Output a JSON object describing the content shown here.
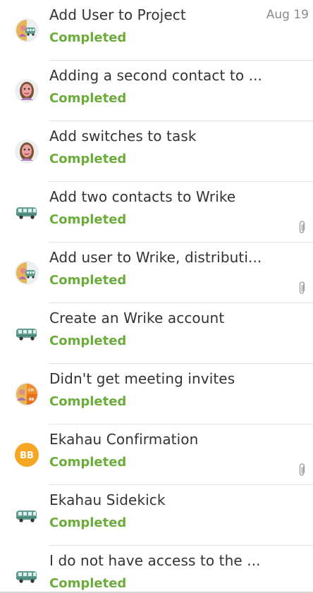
{
  "tasks": [
    {
      "title": "Add User to Project",
      "status": "Completed",
      "date": "Aug 19",
      "avatar": "user-bus-avatar-icon",
      "attachment": false
    },
    {
      "title": "Adding a second contact to ...",
      "status": "Completed",
      "avatar": "user-avatar-icon",
      "attachment": false
    },
    {
      "title": "Add switches to task",
      "status": "Completed",
      "avatar": "user-avatar-icon",
      "attachment": false
    },
    {
      "title": "Add two contacts to Wrike",
      "status": "Completed",
      "avatar": "bus-avatar-icon",
      "attachment": true
    },
    {
      "title": "Add user to Wrike, distributi...",
      "status": "Completed",
      "avatar": "user-bus-avatar-icon",
      "attachment": true
    },
    {
      "title": "Create an Wrike account",
      "status": "Completed",
      "avatar": "bus-avatar-icon",
      "attachment": false
    },
    {
      "title": "Didn't get meeting invites",
      "status": "Completed",
      "avatar": "group-avatar-icon",
      "attachment": false
    },
    {
      "title": "Ekahau Confirmation",
      "status": "Completed",
      "avatar": "initials-avatar",
      "initials": "BB",
      "attachment": true
    },
    {
      "title": "Ekahau Sidekick",
      "status": "Completed",
      "avatar": "bus-avatar-icon",
      "attachment": false
    },
    {
      "title": "I do not have access to the ...",
      "status": "Completed",
      "avatar": "bus-avatar-icon",
      "attachment": false
    }
  ],
  "colors": {
    "status_completed": "#6aac39",
    "avatar_orange": "#f5a623",
    "bus_teal": "#5e9e92"
  }
}
